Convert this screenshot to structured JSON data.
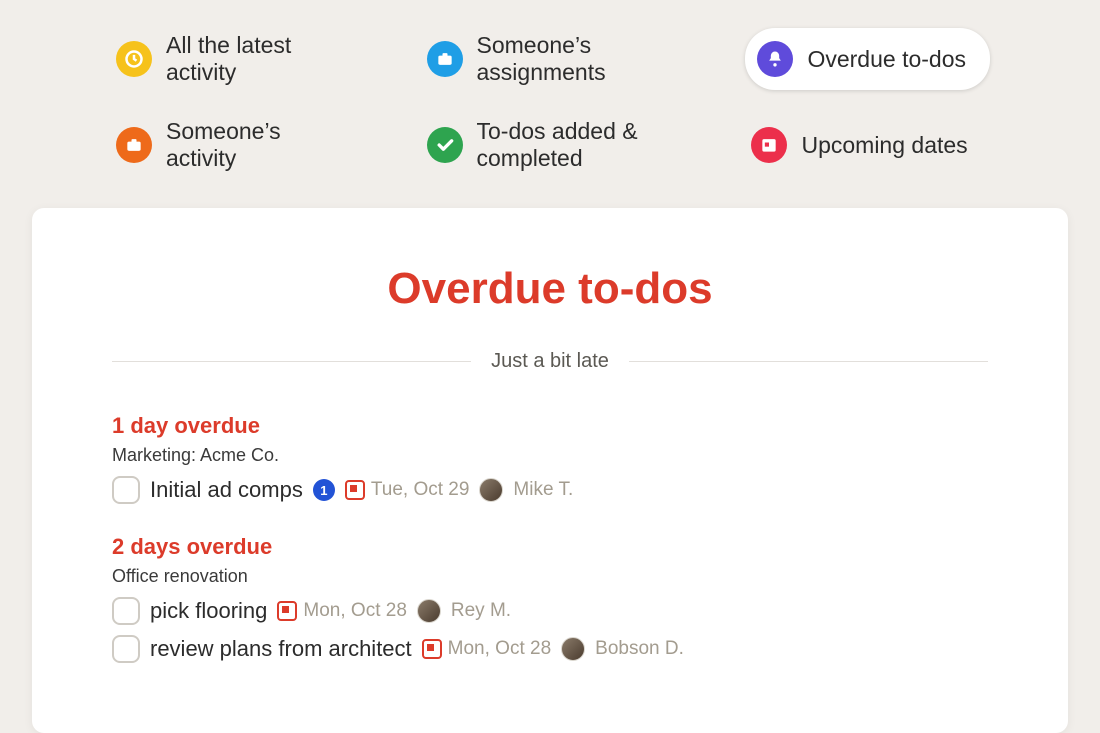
{
  "nav": {
    "items": [
      {
        "label": "All the latest activity",
        "icon": "clock-icon",
        "color": "ic-yellow",
        "active": false
      },
      {
        "label": "Someone’s assignments",
        "icon": "briefcase-icon",
        "color": "ic-blue",
        "active": false
      },
      {
        "label": "Overdue to-dos",
        "icon": "bell-icon",
        "color": "ic-purple",
        "active": true
      },
      {
        "label": "Someone’s activity",
        "icon": "briefcase-icon",
        "color": "ic-orange",
        "active": false
      },
      {
        "label": "To-dos added & completed",
        "icon": "check-icon",
        "color": "ic-green",
        "active": false
      },
      {
        "label": "Upcoming dates",
        "icon": "calendar-icon",
        "color": "ic-red",
        "active": false
      }
    ]
  },
  "page": {
    "title": "Overdue to-dos",
    "divider_label": "Just a bit late"
  },
  "sections": [
    {
      "heading": "1 day overdue",
      "project": "Marketing: Acme Co.",
      "todos": [
        {
          "title": "Initial ad comps",
          "count": "1",
          "date": "Tue, Oct 29",
          "assignee": "Mike T."
        }
      ]
    },
    {
      "heading": "2 days overdue",
      "project": "Office renovation",
      "todos": [
        {
          "title": "pick flooring",
          "count": null,
          "date": "Mon, Oct 28",
          "assignee": "Rey M."
        },
        {
          "title": "review plans from architect",
          "count": null,
          "date": "Mon, Oct 28",
          "assignee": "Bobson D."
        }
      ]
    }
  ]
}
